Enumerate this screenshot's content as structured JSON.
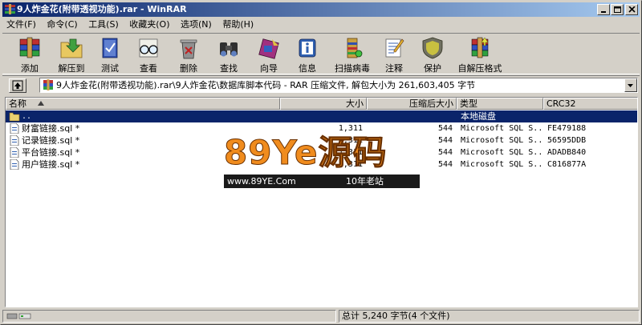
{
  "window": {
    "title": "9人炸金花(附带透视功能).rar - WinRAR"
  },
  "menu": [
    {
      "label": "文件(F)"
    },
    {
      "label": "命令(C)"
    },
    {
      "label": "工具(S)"
    },
    {
      "label": "收藏夹(O)"
    },
    {
      "label": "选项(N)"
    },
    {
      "label": "帮助(H)"
    }
  ],
  "toolbar": {
    "add": "添加",
    "extract_to": "解压到",
    "test": "测试",
    "view": "查看",
    "delete": "删除",
    "find": "查找",
    "wizard": "向导",
    "info": "信息",
    "virus_scan": "扫描病毒",
    "comment": "注释",
    "protect": "保护",
    "sfx": "自解压格式"
  },
  "address": {
    "path": "9人炸金花(附带透视功能).rar\\9人炸金花\\数据库脚本代码 - RAR 压缩文件, 解包大小为 261,603,405 字节"
  },
  "columns": {
    "name": "名称",
    "size": "大小",
    "packed": "压缩后大小",
    "type": "类型",
    "crc": "CRC32"
  },
  "rows": [
    {
      "name": "..",
      "size": "",
      "packed": "",
      "type": "本地磁盘",
      "crc": "",
      "selected": true
    },
    {
      "name": "财富链接.sql *",
      "size": "1,311",
      "packed": "544",
      "type": "Microsoft SQL S...",
      "crc": "FE479188"
    },
    {
      "name": "记录链接.sql *",
      "size": "1,311",
      "packed": "544",
      "type": "Microsoft SQL S...",
      "crc": "56595DDB"
    },
    {
      "name": "平台链接.sql *",
      "size": "1,311",
      "packed": "544",
      "type": "Microsoft SQL S...",
      "crc": "ADADB840"
    },
    {
      "name": "用户链接.sql *",
      "size": "1,311",
      "packed": "544",
      "type": "Microsoft SQL S...",
      "crc": "C816877A"
    }
  ],
  "watermark": {
    "main": "89Ye源码",
    "url": "www.89YE.Com",
    "tagline": "10年老站"
  },
  "status": {
    "right": "总计 5,240 字节(4 个文件)"
  },
  "colors": {
    "title_start": "#0a246a",
    "title_end": "#a6caf0",
    "selection": "#0a246a",
    "face": "#d4d0c8"
  }
}
